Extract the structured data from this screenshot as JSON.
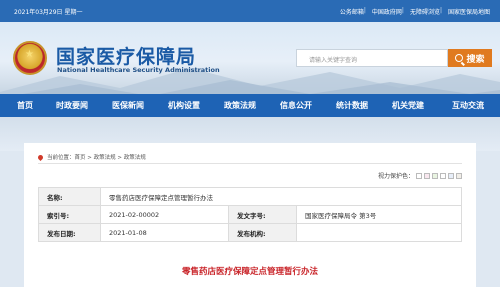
{
  "topbar": {
    "date": "2021年03月29日 星期一",
    "links": [
      "公务邮箱",
      "中国政府网",
      "无障碍浏览",
      "国家医保局地图"
    ]
  },
  "header": {
    "title_cn": "国家医疗保障局",
    "title_en": "National Healthcare Security Administration",
    "search_placeholder": "请输入关键字查询",
    "search_button": "搜索"
  },
  "nav": [
    "首页",
    "时政要闻",
    "医保新闻",
    "机构设置",
    "政策法规",
    "信息公开",
    "统计数据",
    "机关党建",
    "互动交流"
  ],
  "breadcrumb": {
    "text": "当前位置：首页 > 政策法规 > 政策法规"
  },
  "vision": {
    "label": "视力保护色：",
    "colors": [
      "#ffffff",
      "#f9e7ef",
      "#e9f4e1",
      "#ffffff",
      "#e7eef9",
      "#f1eee8"
    ]
  },
  "info": {
    "name_label": "名称:",
    "name_value": "零售药店医疗保障定点管理暂行办法",
    "index_label": "索引号:",
    "index_value": "2021-02-00002",
    "docno_label": "发文字号:",
    "docno_value": "国家医疗保障局令 第3号",
    "date_label": "发布日期:",
    "date_value": "2021-01-08",
    "org_label": "发布机构:",
    "org_value": ""
  },
  "doc_title": "零售药店医疗保障定点管理暂行办法",
  "colors": {
    "brand_blue": "#1e63b5",
    "accent_orange": "#e07a1f",
    "title_red": "#c9252a"
  }
}
